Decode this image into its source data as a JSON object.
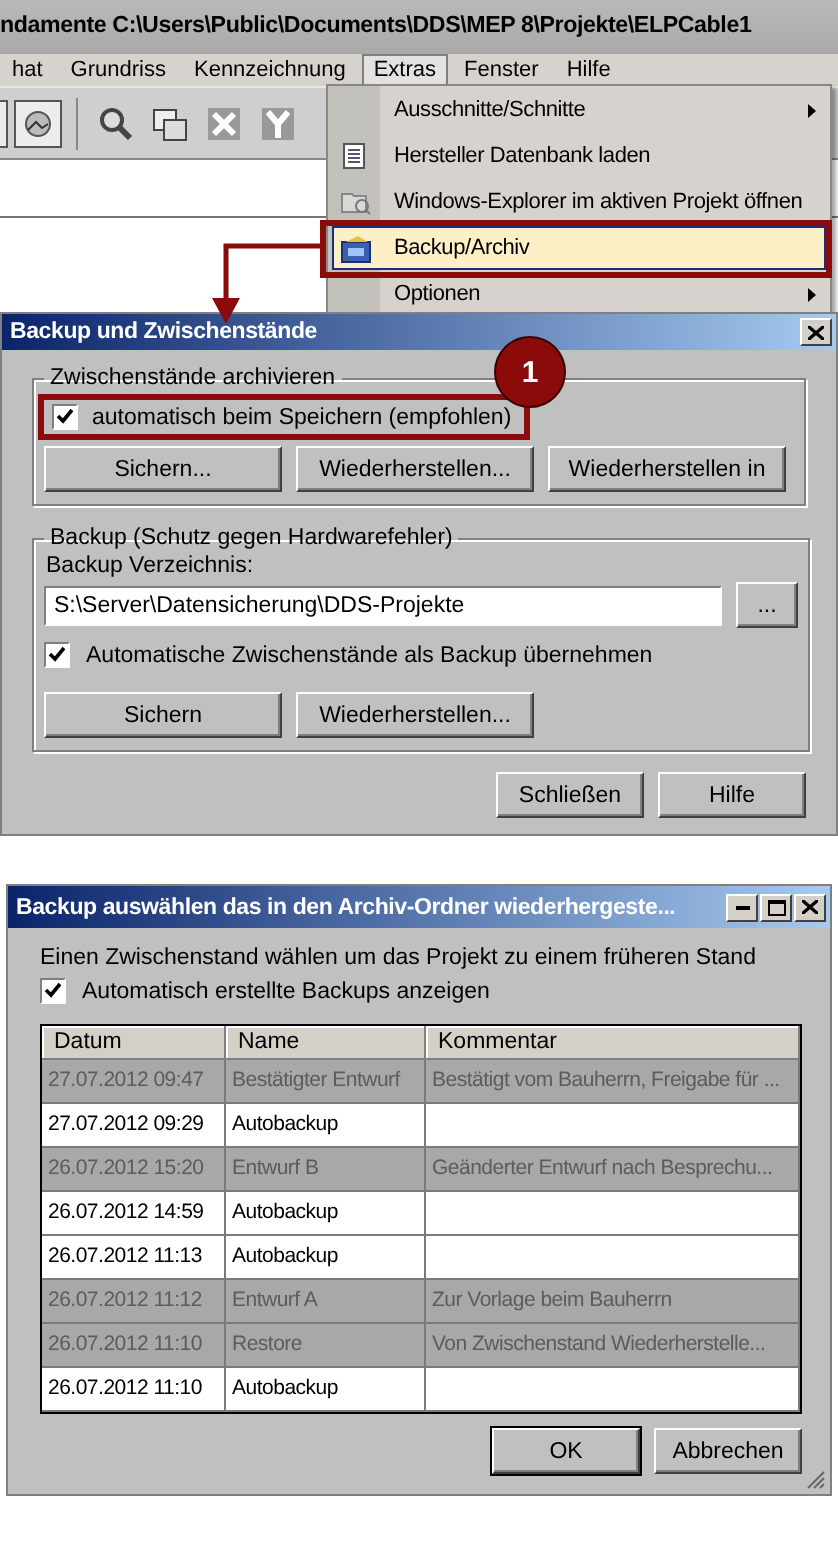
{
  "app_window": {
    "title": "ndamente  C:\\Users\\Public\\Documents\\DDS\\MEP 8\\Projekte\\ELPCable1",
    "menu": [
      {
        "label": "hat",
        "selected": false
      },
      {
        "label": "Grundriss",
        "selected": false
      },
      {
        "label": "Kennzeichnung",
        "selected": false
      },
      {
        "label": "Extras",
        "selected": true
      },
      {
        "label": "Fenster",
        "selected": false
      },
      {
        "label": "Hilfe",
        "selected": false
      }
    ],
    "extras_menu": [
      {
        "label": "Ausschnitte/Schnitte",
        "kind": "submenu",
        "selected": false
      },
      {
        "label": "Hersteller Datenbank laden",
        "kind": "list",
        "selected": false
      },
      {
        "label": "Windows-Explorer im aktiven Projekt öffnen",
        "kind": "explorer",
        "selected": false
      },
      {
        "label": "Backup/Archiv",
        "kind": "archive",
        "selected": true
      },
      {
        "label": "Optionen",
        "kind": "submenu",
        "selected": false
      }
    ]
  },
  "callout": {
    "badge": "1"
  },
  "backup_dialog": {
    "title": "Backup und Zwischenstände",
    "archive_group": {
      "title": "Zwischenstände archivieren",
      "auto_save": {
        "label": "automatisch beim Speichern (empfohlen)",
        "checked": true
      },
      "buttons": [
        "Sichern...",
        "Wiederherstellen...",
        "Wiederherstellen in"
      ]
    },
    "backup_group": {
      "title": "Backup (Schutz gegen Hardwarefehler)",
      "directory_label": "Backup Verzeichnis:",
      "directory": "S:\\Server\\Datensicherung\\DDS-Projekte",
      "browse_button": "...",
      "take_over": {
        "label": "Automatische Zwischenstände als Backup übernehmen",
        "checked": true
      },
      "buttons": [
        "Sichern",
        "Wiederherstellen..."
      ]
    },
    "buttons": [
      "Schließen",
      "Hilfe"
    ]
  },
  "restore_dialog": {
    "title": "Backup auswählen das in den Archiv-Ordner wiederhergeste...",
    "intro": "Einen Zwischenstand wählen um das Projekt zu einem früheren Stand",
    "show_auto": {
      "label": "Automatisch erstellte Backups anzeigen",
      "checked": true
    },
    "table": {
      "columns": [
        "Datum",
        "Name",
        "Kommentar"
      ],
      "rows": [
        {
          "date": "27.07.2012 09:47",
          "name": "Bestätigter Entwurf",
          "comment": "Bestätigt vom Bauherrn, Freigabe für ...",
          "shaded": true
        },
        {
          "date": "27.07.2012 09:29",
          "name": "Autobackup",
          "shaded": false
        },
        {
          "date": "26.07.2012 15:20",
          "name": "Entwurf B",
          "comment": "Geänderter Entwurf nach Besprechu...",
          "shaded": true
        },
        {
          "date": "26.07.2012 14:59",
          "name": "Autobackup",
          "shaded": false
        },
        {
          "date": "26.07.2012 11:13",
          "name": "Autobackup",
          "shaded": false
        },
        {
          "date": "26.07.2012 11:12",
          "name": "Entwurf A",
          "comment": "Zur Vorlage beim Bauherrn",
          "shaded": true
        },
        {
          "date": "26.07.2012 11:10",
          "name": "Restore",
          "comment": "Von Zwischenstand Wiederherstelle...",
          "shaded": true
        },
        {
          "date": "26.07.2012 11:10",
          "name": "Autobackup",
          "shaded": false
        }
      ]
    },
    "buttons": [
      "OK",
      "Abbrechen"
    ]
  }
}
